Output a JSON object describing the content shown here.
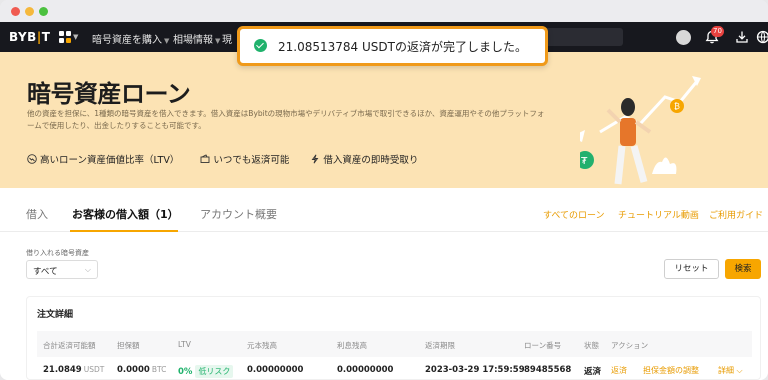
{
  "nav": {
    "logo_main": "BYB",
    "logo_bar": "|",
    "logo_end": "T",
    "items": [
      {
        "label": "暗号資産を購入"
      },
      {
        "label": "相場情報"
      },
      {
        "label": "現"
      }
    ],
    "notification_count": "70"
  },
  "toast": {
    "message": "21.08513784 USDTの返済が完了しました。"
  },
  "hero": {
    "title": "暗号資産ローン",
    "description": "他の資産を担保に、1種類の暗号資産を借入できます。借入資産はBybitの現物市場やデリバティブ市場で取引できるほか、資産運用やその他プラットフォームで使用したり、出金したりすることも可能です。",
    "features": [
      {
        "label": "高いローン資産価値比率（LTV）",
        "icon": "trend-down-icon"
      },
      {
        "label": "いつでも返済可能",
        "icon": "wallet-icon"
      },
      {
        "label": "借入資産の即時受取り",
        "icon": "lightning-icon"
      }
    ]
  },
  "tabs": [
    {
      "label": "借入"
    },
    {
      "label": "お客様の借入額（1）"
    },
    {
      "label": "アカウント概要"
    }
  ],
  "links": {
    "all_loans": "すべてのローン",
    "tutorial": "チュートリアル動画",
    "guide": "ご利用ガイド"
  },
  "filter": {
    "label": "借り入れる暗号資産",
    "selected": "すべて",
    "reset": "リセット",
    "search": "検索"
  },
  "orders": {
    "title": "注文詳細",
    "columns": [
      "合計返済可能額",
      "担保額",
      "LTV",
      "元本残高",
      "利息残高",
      "返済期限",
      "ローン番号",
      "状態",
      "アクション"
    ],
    "rows": [
      {
        "total_repay": "21.0849",
        "total_unit": "USDT",
        "collateral": "0.0000",
        "collateral_unit": "BTC",
        "ltv": "0%",
        "risk": "低リスク",
        "principal": "0.00000000",
        "interest": "0.00000000",
        "due": "2023-03-29 17:59:59",
        "loan_no": "89485568",
        "status": "返済",
        "actions": {
          "repay": "返済",
          "adjust": "担保金額の調整",
          "detail": "詳細"
        }
      }
    ]
  },
  "colors": {
    "accent": "#f7a600",
    "success": "#20b26c",
    "hero_bg": "#fce3b4"
  }
}
